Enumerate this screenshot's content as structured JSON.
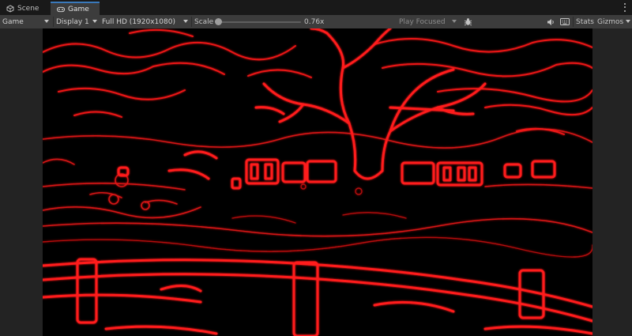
{
  "tabs": [
    {
      "label": "Scene",
      "icon": "scene-icon"
    },
    {
      "label": "Game",
      "icon": "gamepad-icon"
    }
  ],
  "toolbar": {
    "view_mode": "Game",
    "display": "Display 1",
    "resolution": "Full HD (1920x1080)",
    "scale_label": "Scale",
    "scale_value": "0.76x",
    "scale_fraction": 0.0,
    "play_mode": "Play Focused",
    "stats_label": "Stats",
    "gizmos_label": "Gizmos"
  },
  "colors": {
    "edge_red": "#ff1a1a",
    "accent_blue": "#3a79bb",
    "toolbar_bg": "#3c3c3c"
  },
  "game_view": {
    "content": "red edge-detection render of a night scene with a large tree, houses and a fence"
  }
}
